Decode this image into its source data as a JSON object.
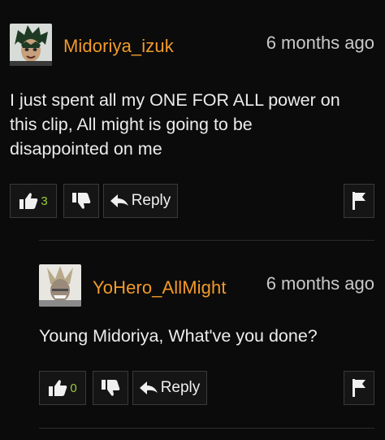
{
  "comments": [
    {
      "username": "Midoriya_izuk",
      "timestamp": "6 months ago",
      "text": "I just spent all my ONE FOR ALL power on\nthis clip, All might is going to be\ndisappointed on me",
      "likes": "3",
      "reply_label": "Reply",
      "avatar_icon": "avatar-midoriya",
      "like_icon": "thumbs-up-icon",
      "dislike_icon": "thumbs-down-icon",
      "reply_icon": "reply-arrow-icon",
      "flag_icon": "flag-icon"
    },
    {
      "username": "YoHero_AllMight",
      "timestamp": "6 months ago",
      "text": "Young Midoriya, What've you done?",
      "likes": "0",
      "reply_label": "Reply",
      "avatar_icon": "avatar-allmight",
      "like_icon": "thumbs-up-icon",
      "dislike_icon": "thumbs-down-icon",
      "reply_icon": "reply-arrow-icon",
      "flag_icon": "flag-icon"
    }
  ],
  "colors": {
    "background": "#0b0b0b",
    "username": "#f19a2a",
    "like_count": "#9bcc38",
    "button_border": "#3a3a3a"
  }
}
